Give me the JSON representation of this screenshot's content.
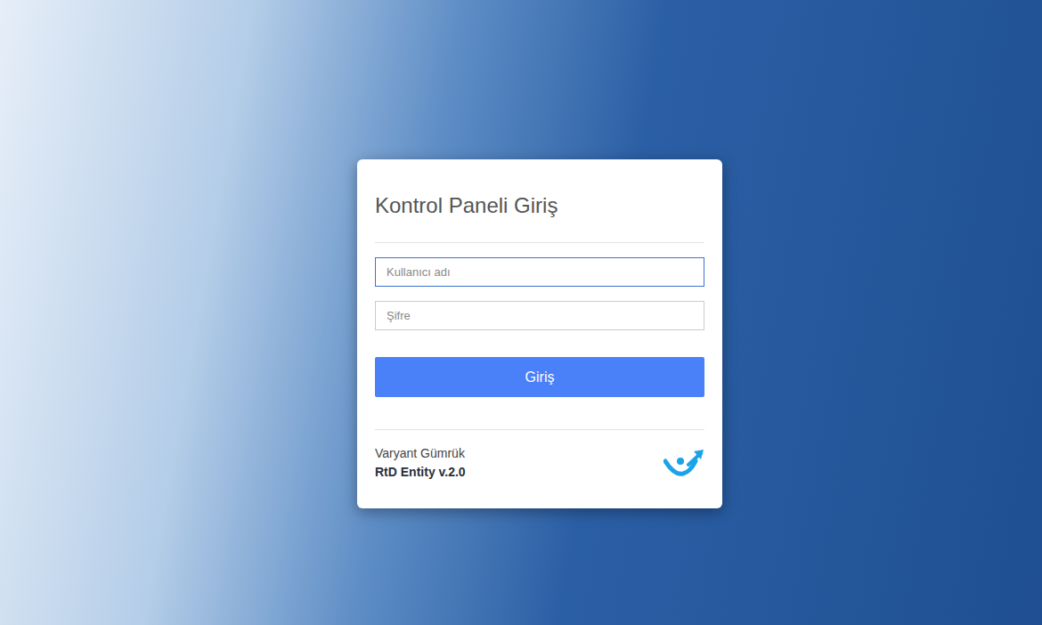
{
  "login": {
    "title": "Kontrol Paneli Giriş",
    "fields": [
      {
        "placeholder": "Kullanıcı adı",
        "type": "text",
        "focused": true
      },
      {
        "placeholder": "Şifre",
        "type": "password",
        "focused": false
      }
    ],
    "button": "Giriş"
  },
  "footer": {
    "company": "Varyant Gümrük",
    "product": "RtD Entity v.2.0"
  }
}
